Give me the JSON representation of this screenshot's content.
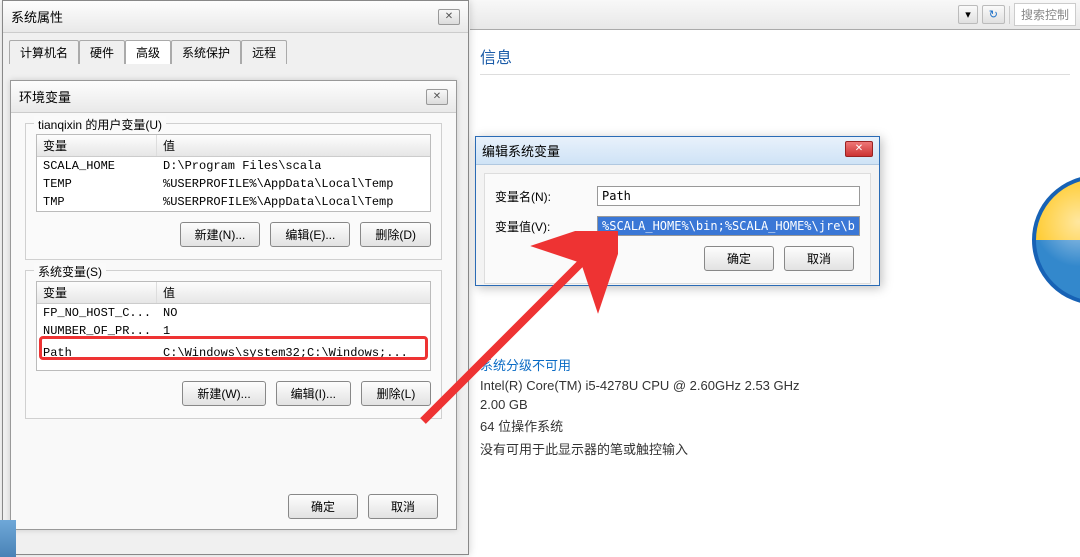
{
  "bg": {
    "search_placeholder": "搜索控制",
    "info_title": "信息",
    "rating_label": "系统分级不可用",
    "cpu": "Intel(R) Core(TM) i5-4278U CPU @ 2.60GHz   2.53 GHz",
    "ram": "2.00 GB",
    "os_bits": "64 位操作系统",
    "pen_touch": "没有可用于此显示器的笔或触控输入"
  },
  "sysprops": {
    "title": "系统属性",
    "tabs": [
      "计算机名",
      "硬件",
      "高级",
      "系统保护",
      "远程"
    ]
  },
  "envvars": {
    "title": "环境变量",
    "user_group": "tianqixin 的用户变量(U)",
    "col_var": "变量",
    "col_val": "值",
    "user_rows": [
      {
        "name": "SCALA_HOME",
        "value": "D:\\Program Files\\scala"
      },
      {
        "name": "TEMP",
        "value": "%USERPROFILE%\\AppData\\Local\\Temp"
      },
      {
        "name": "TMP",
        "value": "%USERPROFILE%\\AppData\\Local\\Temp"
      }
    ],
    "sys_group": "系统变量(S)",
    "sys_rows": [
      {
        "name": "FP_NO_HOST_C...",
        "value": "NO"
      },
      {
        "name": "NUMBER_OF_PR...",
        "value": "1"
      },
      {
        "name": "Path",
        "value": "C:\\Windows\\system32;C:\\Windows;..."
      }
    ],
    "btn_new_n": "新建(N)...",
    "btn_edit_e": "编辑(E)...",
    "btn_del_d": "删除(D)",
    "btn_new_w": "新建(W)...",
    "btn_edit_i": "编辑(I)...",
    "btn_del_l": "删除(L)",
    "btn_ok": "确定",
    "btn_cancel": "取消"
  },
  "editvar": {
    "title": "编辑系统变量",
    "name_label": "变量名(N):",
    "name_value": "Path",
    "value_label": "变量值(V):",
    "value_value": "%SCALA_HOME%\\bin;%SCALA_HOME%\\jre\\b",
    "btn_ok": "确定",
    "btn_cancel": "取消"
  }
}
